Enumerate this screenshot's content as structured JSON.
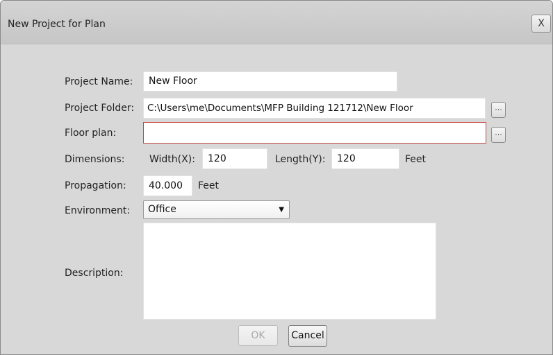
{
  "window": {
    "title": "New Project for Plan",
    "close_label": "X"
  },
  "form": {
    "project_name": {
      "label": "Project Name:",
      "value": "New Floor"
    },
    "project_folder": {
      "label": "Project Folder:",
      "value": "C:\\Users\\me\\Documents\\MFP Building 121712\\New Floor",
      "browse_label": "..."
    },
    "floor_plan": {
      "label": "Floor plan:",
      "value": "",
      "browse_label": "..."
    },
    "dimensions": {
      "label": "Dimensions:",
      "width_label": "Width(X):",
      "width_value": "120",
      "length_label": "Length(Y):",
      "length_value": "120",
      "unit": "Feet"
    },
    "propagation": {
      "label": "Propagation:",
      "value": "40.000",
      "unit": "Feet"
    },
    "environment": {
      "label": "Environment:",
      "selected": "Office"
    },
    "description": {
      "label": "Description:",
      "value": ""
    }
  },
  "buttons": {
    "ok": "OK",
    "cancel": "Cancel"
  },
  "colors": {
    "dialog_background": "#d8d8d8",
    "error_border": "#c64444",
    "field_background": "#ffffff"
  }
}
